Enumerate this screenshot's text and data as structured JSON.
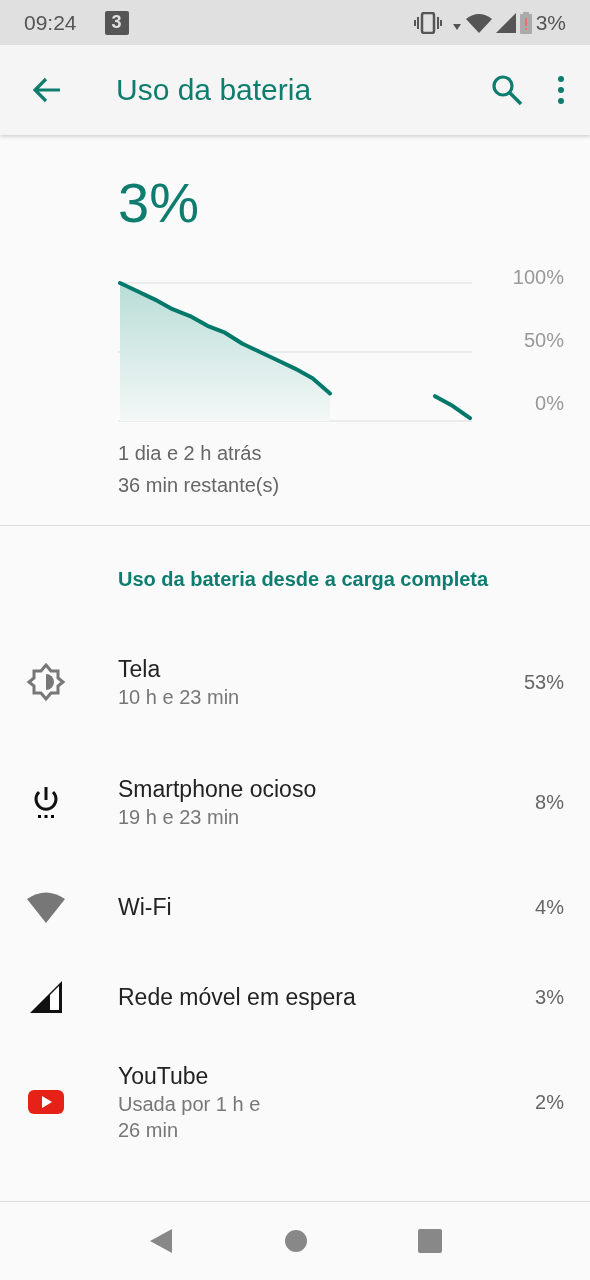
{
  "status_bar": {
    "time": "09:24",
    "notification": "3",
    "battery": "3%"
  },
  "app_bar": {
    "title": "Uso da bateria"
  },
  "summary": {
    "percent": "3%",
    "since": "1 dia e 2 h atrás",
    "remaining": "36 min restante(s)",
    "axis_labels": [
      "100%",
      "50%",
      "0%"
    ]
  },
  "section_title": "Uso da bateria desde a carga completa",
  "items": [
    {
      "kind": "display",
      "name": "Tela",
      "detail": "10 h e 23 min",
      "percent": "53%"
    },
    {
      "kind": "idle",
      "name": "Smartphone ocioso",
      "detail": "19 h e 23 min",
      "percent": "8%"
    },
    {
      "kind": "wifi",
      "name": "Wi-Fi",
      "percent": "4%"
    },
    {
      "kind": "mobile",
      "name": "Rede móvel em espera",
      "percent": "3%"
    },
    {
      "kind": "app",
      "name": "YouTube",
      "detail": "Usada por 1 h e 26 min",
      "percent": "2%"
    }
  ]
}
